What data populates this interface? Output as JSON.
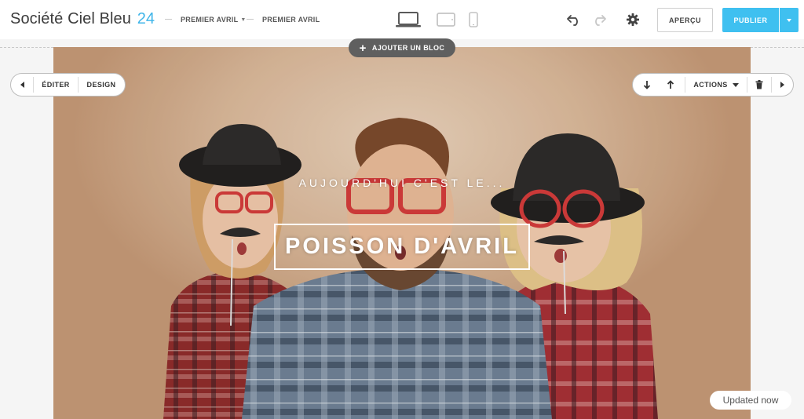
{
  "app": {
    "brand_name": "Société Ciel Bleu",
    "brand_number": "24",
    "accent_color": "#3fc0f0"
  },
  "breadcrumb": [
    {
      "label": "PREMIER AVRIL",
      "has_dropdown": true
    },
    {
      "label": "PREMIER AVRIL",
      "has_dropdown": false
    }
  ],
  "devices": [
    "laptop-icon",
    "tablet-icon",
    "phone-icon"
  ],
  "toolbar": {
    "preview_label": "APERÇU",
    "publish_label": "PUBLIER"
  },
  "block_controls": {
    "add_block_label": "AJOUTER UN BLOC",
    "edit_label": "ÉDITER",
    "design_label": "DESIGN",
    "actions_label": "ACTIONS"
  },
  "hero": {
    "subtitle": "AUJOURD'HUI C'EST LE...",
    "title": "POISSON D'AVRIL"
  },
  "status": {
    "toast": "Updated now"
  }
}
